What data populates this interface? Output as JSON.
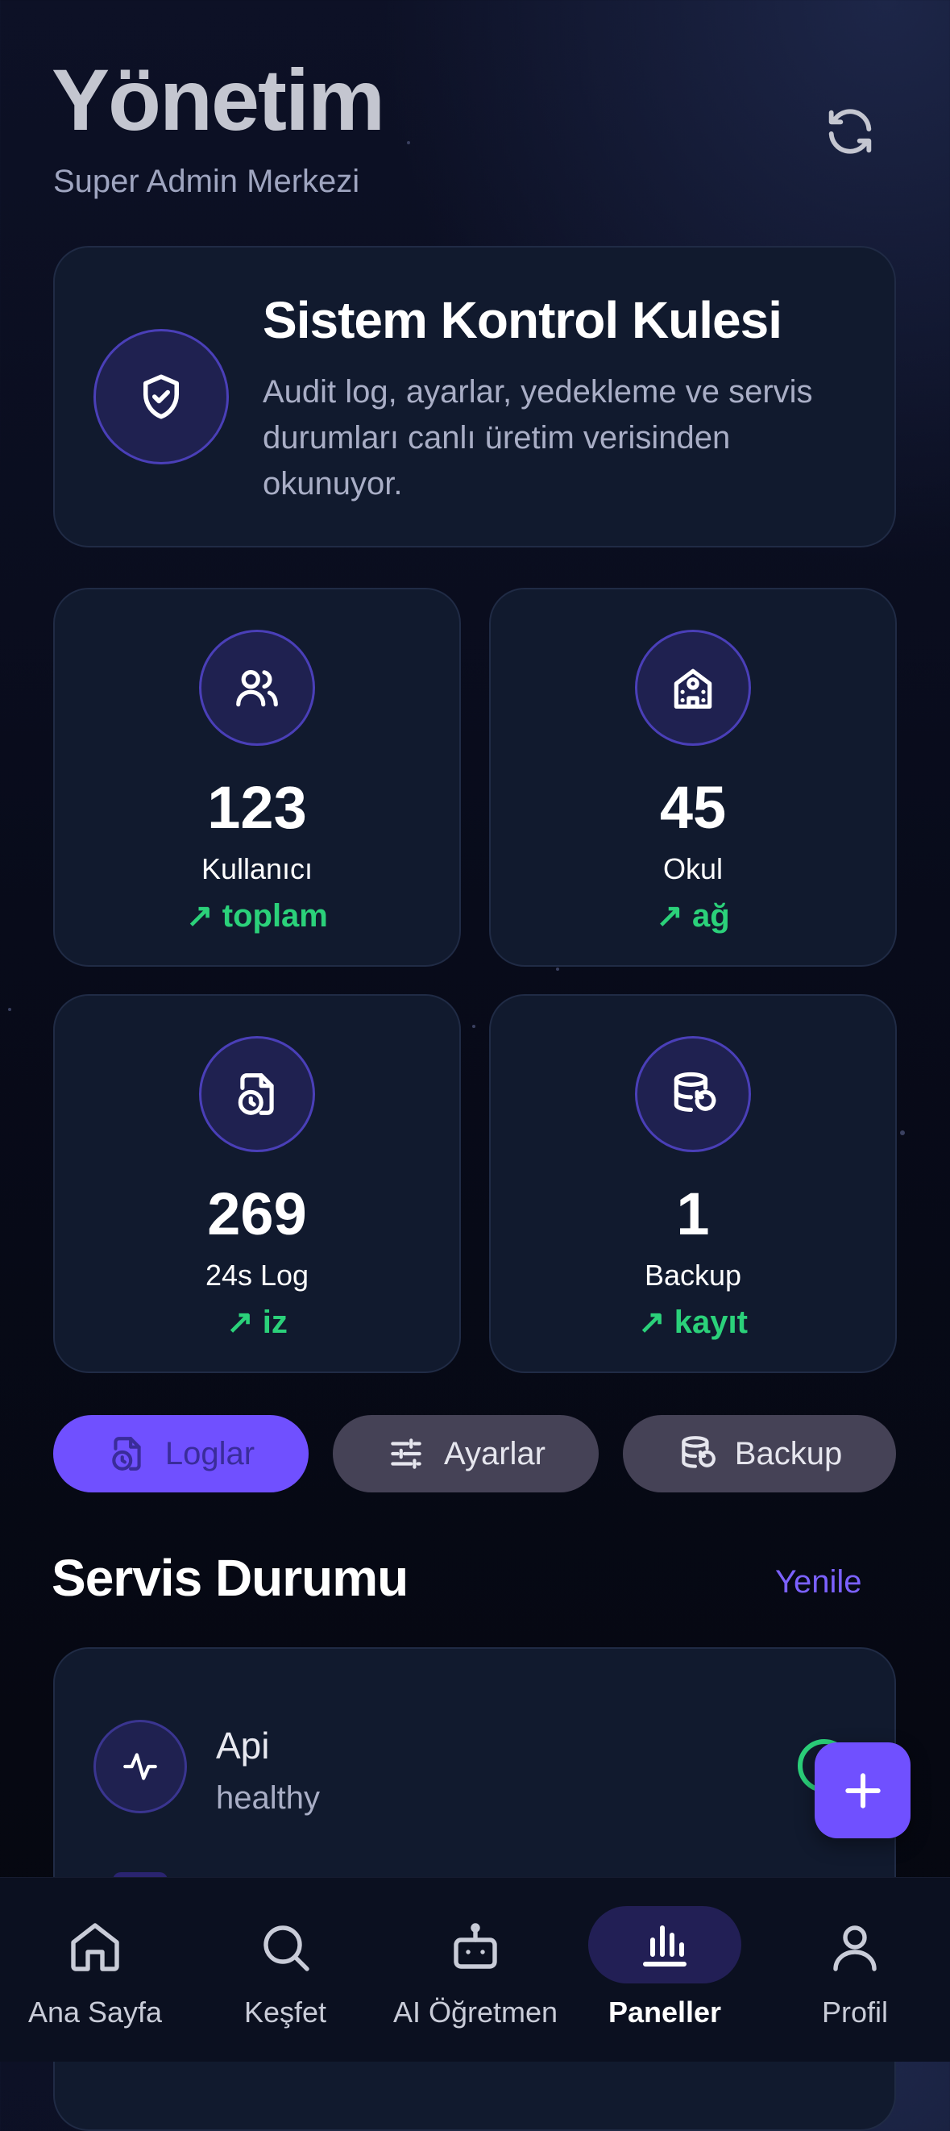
{
  "header": {
    "title": "Yönetim",
    "subtitle": "Super Admin Merkezi",
    "refresh_icon": "refresh-icon"
  },
  "hero": {
    "title": "Sistem Kontrol Kulesi",
    "description": "Audit log, ayarlar, yedekleme ve servis durumları canlı üretim verisinden okunuyor.",
    "icon": "shield-check-icon"
  },
  "stats": [
    {
      "icon": "users-icon",
      "value": "123",
      "label": "Kullanıcı",
      "trend": "↗ toplam"
    },
    {
      "icon": "school-icon",
      "value": "45",
      "label": "Okul",
      "trend": "↗ ağ"
    },
    {
      "icon": "file-clock-icon",
      "value": "269",
      "label": "24s Log",
      "trend": "↗ iz"
    },
    {
      "icon": "database-restore-icon",
      "value": "1",
      "label": "Backup",
      "trend": "↗ kayıt"
    }
  ],
  "chips": [
    {
      "label": "Loglar",
      "active": true
    },
    {
      "label": "Ayarlar",
      "active": false
    },
    {
      "label": "Backup",
      "active": false
    }
  ],
  "services": {
    "title": "Servis Durumu",
    "action": "Yenile",
    "items": [
      {
        "name": "Api",
        "status": "healthy"
      }
    ]
  },
  "nav": [
    {
      "label": "Ana Sayfa",
      "icon": "home-icon"
    },
    {
      "label": "Keşfet",
      "icon": "search-icon"
    },
    {
      "label": "AI Öğretmen",
      "icon": "robot-icon"
    },
    {
      "label": "Paneller",
      "icon": "bar-chart-icon",
      "active": true
    },
    {
      "label": "Profil",
      "icon": "user-icon"
    }
  ],
  "colors": {
    "accent": "#7050ff",
    "positive": "#2bd17a",
    "card": "#111a2e",
    "chip_inactive": "#454256"
  }
}
